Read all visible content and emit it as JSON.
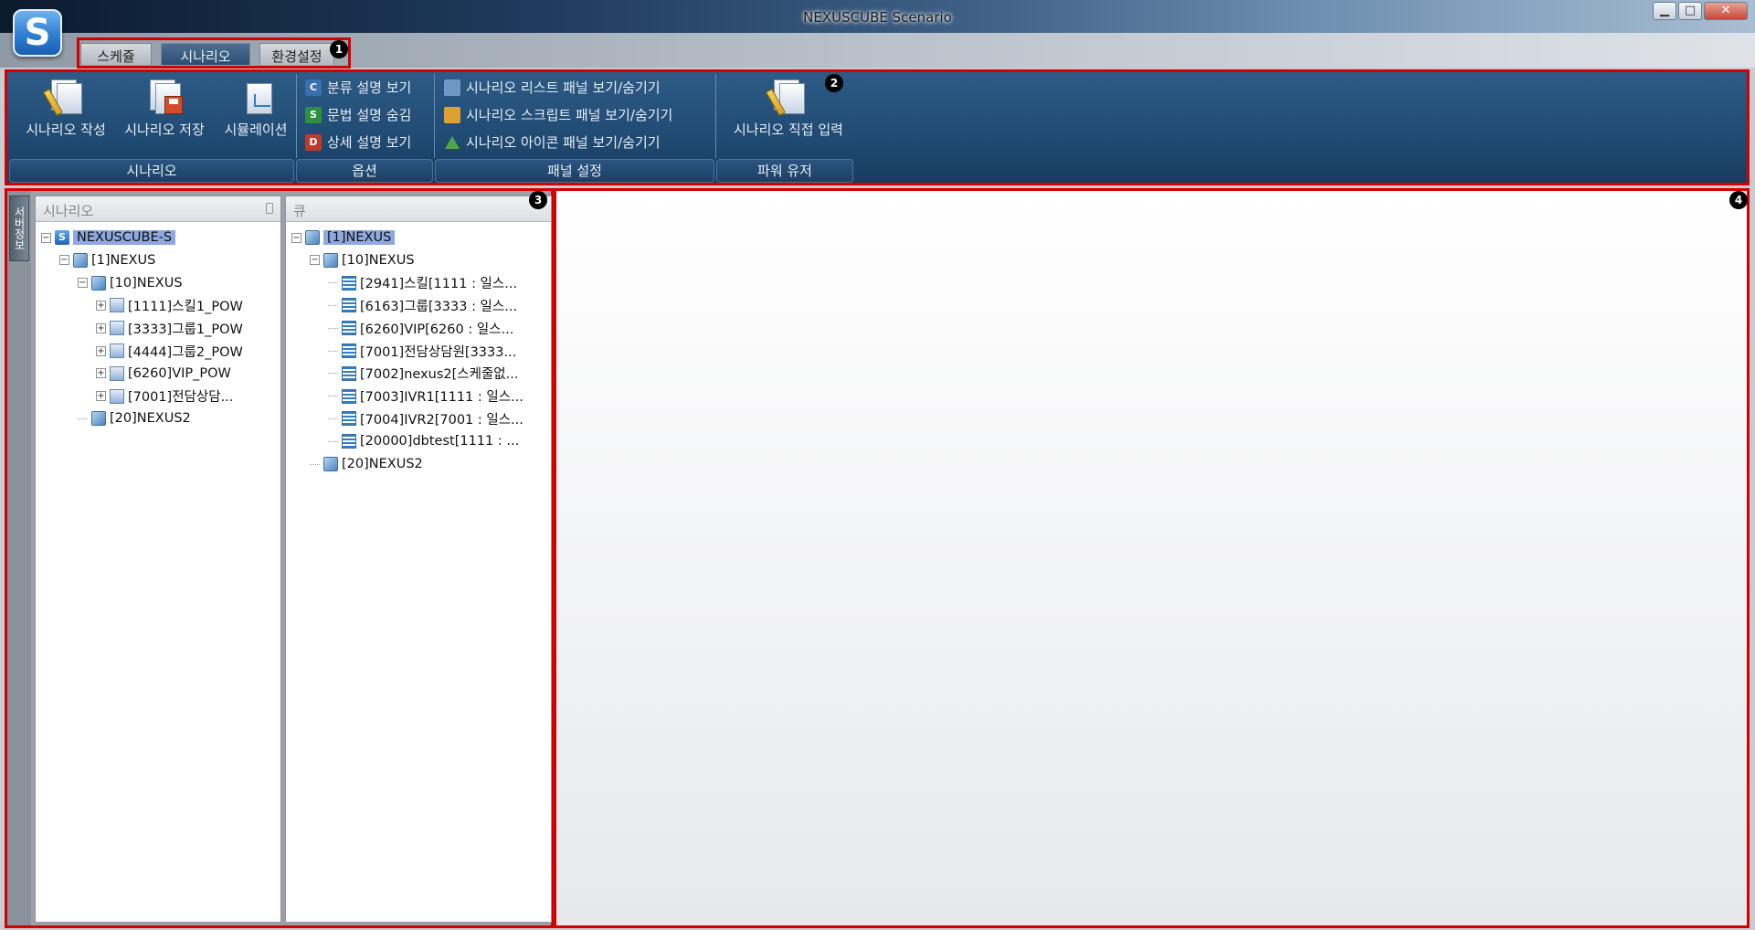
{
  "window": {
    "title": "NEXUSCUBE Scenario",
    "logo_letter": "S",
    "minimize": "▁",
    "maximize": "□",
    "close": "✕"
  },
  "tabs": [
    {
      "label": "스케쥴",
      "active": false
    },
    {
      "label": "시나리오",
      "active": true
    },
    {
      "label": "환경설정",
      "active": false
    }
  ],
  "badges": [
    "1",
    "2",
    "3",
    "4"
  ],
  "ribbon": {
    "scenario_group": {
      "label": "시나리오",
      "buttons": [
        {
          "label": "시나리오 작성",
          "icon": "scenario-write-icon"
        },
        {
          "label": "시나리오 저장",
          "icon": "scenario-save-icon"
        },
        {
          "label": "시뮬레이션",
          "icon": "simulation-icon"
        }
      ]
    },
    "options_group": {
      "label": "옵션",
      "items": [
        {
          "label": "분류 설명 보기",
          "icon": "category-desc-icon",
          "glyph": "C"
        },
        {
          "label": "문법 설명 숨김",
          "icon": "syntax-desc-icon",
          "glyph": "S"
        },
        {
          "label": "상세 설명 보기",
          "icon": "detail-desc-icon",
          "glyph": "D"
        }
      ]
    },
    "panel_group": {
      "label": "패널 설정",
      "items": [
        {
          "label": "시나리오 리스트 패널 보기/숨기기",
          "icon": "list-panel-icon"
        },
        {
          "label": "시나리오 스크립트 패널 보기/숨기기",
          "icon": "script-panel-icon"
        },
        {
          "label": "시나리오 아이콘 패널 보기/숨기기",
          "icon": "icon-panel-icon"
        }
      ]
    },
    "power_group": {
      "label": "파워 유저",
      "buttons": [
        {
          "label": "시나리오 직접 입력",
          "icon": "direct-input-icon"
        }
      ]
    }
  },
  "side_tab": "서버정보",
  "scenario_panel": {
    "title": "시나리오",
    "tree": [
      {
        "label": "NEXUSCUBE-S",
        "icon": "s-logo",
        "level": 0,
        "selected": true,
        "expander": "−"
      },
      {
        "label": "[1]NEXUS",
        "icon": "cube",
        "level": 1,
        "expander": "−"
      },
      {
        "label": "[10]NEXUS",
        "icon": "cube",
        "level": 2,
        "expander": "−"
      },
      {
        "label": "[1111]스킬1_POW",
        "icon": "doc",
        "level": 3,
        "expander": "+"
      },
      {
        "label": "[3333]그룹1_POW",
        "icon": "doc",
        "level": 3,
        "expander": "+"
      },
      {
        "label": "[4444]그룹2_POW",
        "icon": "doc",
        "level": 3,
        "expander": "+"
      },
      {
        "label": "[6260]VIP_POW",
        "icon": "doc",
        "level": 3,
        "expander": "+"
      },
      {
        "label": "[7001]전담상담...",
        "icon": "doc",
        "level": 3,
        "expander": "+"
      },
      {
        "label": "[20]NEXUS2",
        "icon": "cube",
        "level": 2,
        "expander": ""
      }
    ]
  },
  "queue_panel": {
    "title": "큐",
    "tree": [
      {
        "label": "[1]NEXUS",
        "icon": "cube",
        "level": 0,
        "selected": true,
        "expander": "−"
      },
      {
        "label": "[10]NEXUS",
        "icon": "cube",
        "level": 1,
        "expander": "−"
      },
      {
        "label": "[2941]스킬[1111 : 일스...",
        "icon": "queue",
        "level": 2,
        "expander": ""
      },
      {
        "label": "[6163]그룹[3333 : 일스...",
        "icon": "queue",
        "level": 2,
        "expander": ""
      },
      {
        "label": "[6260]VIP[6260 : 일스...",
        "icon": "queue",
        "level": 2,
        "expander": ""
      },
      {
        "label": "[7001]전담상담원[3333...",
        "icon": "queue",
        "level": 2,
        "expander": ""
      },
      {
        "label": "[7002]nexus2[스케줄없...",
        "icon": "queue",
        "level": 2,
        "expander": ""
      },
      {
        "label": "[7003]IVR1[1111 : 일스...",
        "icon": "queue",
        "level": 2,
        "expander": ""
      },
      {
        "label": "[7004]IVR2[7001 : 일스...",
        "icon": "queue",
        "level": 2,
        "expander": ""
      },
      {
        "label": "[20000]dbtest[1111 : ...",
        "icon": "queue",
        "level": 2,
        "expander": ""
      },
      {
        "label": "[20]NEXUS2",
        "icon": "cube",
        "level": 1,
        "expander": ""
      }
    ]
  },
  "colors": {
    "highlight_border": "#d40000",
    "ribbon_bg": "#1f4a72",
    "selection": "#8fa9e0"
  }
}
